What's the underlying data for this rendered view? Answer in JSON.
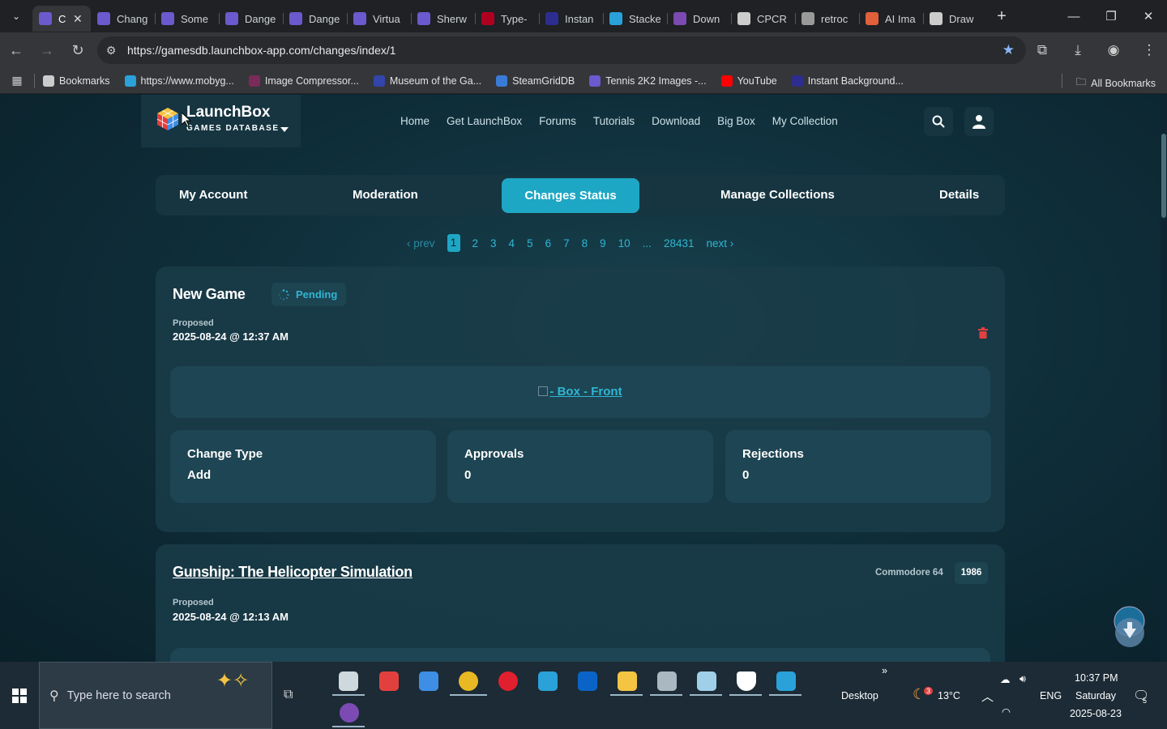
{
  "browser": {
    "tabs": [
      {
        "title": "C",
        "active": true,
        "color": "#6a5acd"
      },
      {
        "title": "Chang",
        "color": "#6a5acd"
      },
      {
        "title": "Some",
        "color": "#6a5acd"
      },
      {
        "title": "Dange",
        "color": "#6a5acd"
      },
      {
        "title": "Dange",
        "color": "#6a5acd"
      },
      {
        "title": "Virtua",
        "color": "#6a5acd"
      },
      {
        "title": "Sherw",
        "color": "#6a5acd"
      },
      {
        "title": "Type-",
        "color": "#b00020"
      },
      {
        "title": "Instan",
        "color": "#2d2d8f"
      },
      {
        "title": "Stacke",
        "color": "#2aa1d9"
      },
      {
        "title": "Down",
        "color": "#7b4bb3"
      },
      {
        "title": "CPCR",
        "color": "#cccccc"
      },
      {
        "title": "retroc",
        "color": "#999999"
      },
      {
        "title": "AI Ima",
        "color": "#e0603a"
      },
      {
        "title": "Draw",
        "color": "#cccccc"
      }
    ],
    "url": "https://gamesdb.launchbox-app.com/changes/index/1",
    "bookmarks": [
      {
        "label": "Bookmarks",
        "color": "#cccccc"
      },
      {
        "label": "https://www.mobyg...",
        "color": "#2aa1d9"
      },
      {
        "label": "Image Compressor...",
        "color": "#7a2b5a"
      },
      {
        "label": "Museum of the Ga...",
        "color": "#3344aa"
      },
      {
        "label": "SteamGridDB",
        "color": "#3a7bd5"
      },
      {
        "label": "Tennis 2K2 Images -...",
        "color": "#6a5acd"
      },
      {
        "label": "YouTube",
        "color": "#ff0000"
      },
      {
        "label": "Instant Background...",
        "color": "#2d2d8f"
      }
    ],
    "all_bookmarks": "All Bookmarks"
  },
  "site": {
    "logo_title": "LaunchBox",
    "logo_sub": "GAMES DATABASE",
    "nav": [
      "Home",
      "Get LaunchBox",
      "Forums",
      "Tutorials",
      "Download",
      "Big Box",
      "My Collection"
    ],
    "accent": "#1ea7c4"
  },
  "tabs": {
    "my_account": "My Account",
    "moderation": "Moderation",
    "changes_status": "Changes Status",
    "manage_collections": "Manage Collections",
    "details": "Details"
  },
  "pager": {
    "prev": "‹ prev",
    "pages": [
      "1",
      "2",
      "3",
      "4",
      "5",
      "6",
      "7",
      "8",
      "9",
      "10"
    ],
    "ellipsis": "...",
    "last": "28431",
    "next": "next ›",
    "current": "1"
  },
  "changes": [
    {
      "title": "New Game",
      "status": "Pending",
      "proposed_label": "Proposed",
      "proposed_date": "2025-08-24 @ 12:37 AM",
      "image_alt": "- Box - Front",
      "change_type_label": "Change Type",
      "change_type": "Add",
      "approvals_label": "Approvals",
      "approvals": "0",
      "rejections_label": "Rejections",
      "rejections": "0"
    },
    {
      "title": "Gunship: The Helicopter Simulation",
      "platform": "Commodore 64",
      "year": "1986",
      "proposed_label": "Proposed",
      "proposed_date": "2025-08-24 @ 12:13 AM"
    }
  ],
  "taskbar": {
    "search_placeholder": "Type here to search",
    "desktop": "Desktop",
    "weather": "13°C",
    "weather_badge": "3",
    "language": "ENG",
    "time": "10:37 PM",
    "day": "Saturday",
    "date": "2025-08-23",
    "notifications": "5"
  }
}
